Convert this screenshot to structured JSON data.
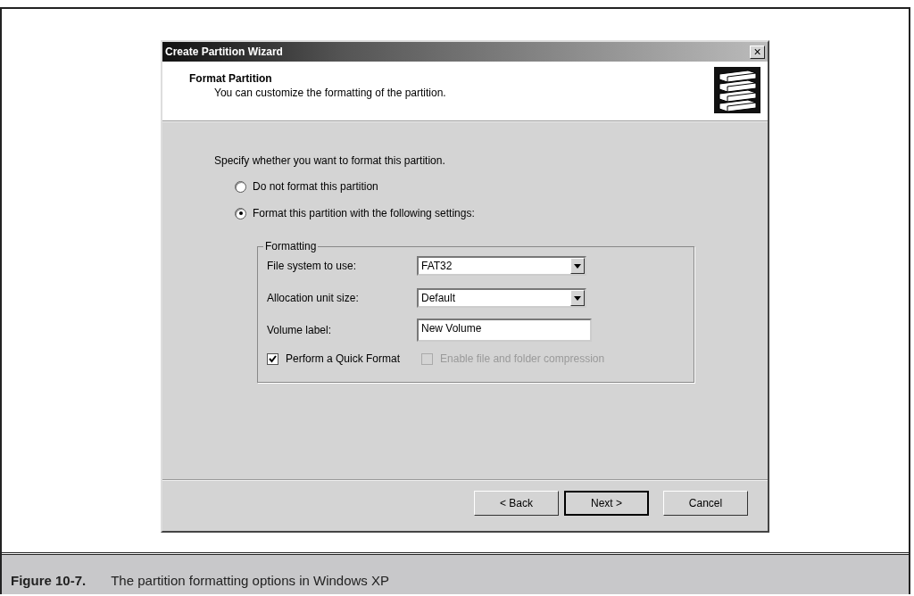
{
  "window": {
    "title": "Create Partition Wizard",
    "close": "×"
  },
  "header": {
    "title": "Format Partition",
    "subtitle": "You can customize the formatting of the partition."
  },
  "prompt": "Specify whether you want to format this partition.",
  "options": [
    {
      "label": "Do not format this partition",
      "selected": false
    },
    {
      "label": "Format this partition with the following settings:",
      "selected": true
    }
  ],
  "formatting": {
    "legend": "Formatting",
    "fields": [
      {
        "kind": "dropdown",
        "label": "File system to use:",
        "value": "FAT32"
      },
      {
        "kind": "dropdown",
        "label": "Allocation unit size:",
        "value": "Default"
      },
      {
        "kind": "text",
        "label": "Volume label:",
        "value": "New Volume"
      }
    ],
    "checkboxes": [
      {
        "label": "Perform a Quick Format",
        "checked": true,
        "disabled": false
      },
      {
        "label": "Enable file and folder compression",
        "checked": false,
        "disabled": true
      }
    ]
  },
  "buttons": [
    {
      "label": "< Back",
      "default": false
    },
    {
      "label": "Next >",
      "default": true
    },
    {
      "label": "Cancel",
      "default": false
    }
  ],
  "caption": {
    "number": "Figure 10-7.",
    "text": "The partition formatting options in Windows XP"
  }
}
